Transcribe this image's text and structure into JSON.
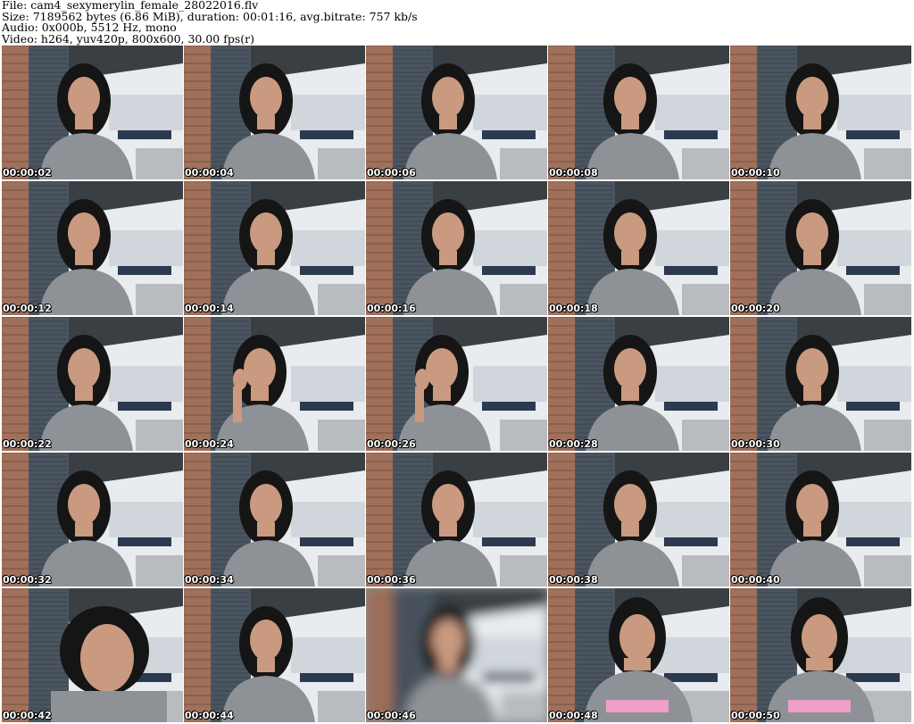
{
  "header": {
    "file": "File: cam4_sexymerylin_female_28022016.flv",
    "size": "Size: 7189562 bytes (6.86 MiB), duration: 00:01:16, avg.bitrate: 757 kb/s",
    "audio": "Audio: 0x000b, 5512 Hz, mono",
    "video": "Video: h264, yuv420p, 800x600, 30.00 fps(r)"
  },
  "frames": [
    {
      "time": "00:00:02",
      "variant": "normal"
    },
    {
      "time": "00:00:04",
      "variant": "normal"
    },
    {
      "time": "00:00:06",
      "variant": "normal"
    },
    {
      "time": "00:00:08",
      "variant": "normal"
    },
    {
      "time": "00:00:10",
      "variant": "normal"
    },
    {
      "time": "00:00:12",
      "variant": "normal"
    },
    {
      "time": "00:00:14",
      "variant": "normal"
    },
    {
      "time": "00:00:16",
      "variant": "normal"
    },
    {
      "time": "00:00:18",
      "variant": "normal"
    },
    {
      "time": "00:00:20",
      "variant": "normal"
    },
    {
      "time": "00:00:22",
      "variant": "normal"
    },
    {
      "time": "00:00:24",
      "variant": "hand"
    },
    {
      "time": "00:00:26",
      "variant": "hand"
    },
    {
      "time": "00:00:28",
      "variant": "normal"
    },
    {
      "time": "00:00:30",
      "variant": "normal"
    },
    {
      "time": "00:00:32",
      "variant": "normal"
    },
    {
      "time": "00:00:34",
      "variant": "normal"
    },
    {
      "time": "00:00:36",
      "variant": "normal"
    },
    {
      "time": "00:00:38",
      "variant": "normal"
    },
    {
      "time": "00:00:40",
      "variant": "normal"
    },
    {
      "time": "00:00:42",
      "variant": "close"
    },
    {
      "time": "00:00:44",
      "variant": "normal"
    },
    {
      "time": "00:00:46",
      "variant": "blur"
    },
    {
      "time": "00:00:48",
      "variant": "shirt"
    },
    {
      "time": "00:00:50",
      "variant": "shirt"
    }
  ],
  "colors": {
    "brick": "#a0705a",
    "shutter": "#4a5560",
    "ceiling": "#3a3f44",
    "window": "#e8ecef",
    "shirt": "#8e9296",
    "hair": "#151515",
    "skin": "#c99a80"
  }
}
